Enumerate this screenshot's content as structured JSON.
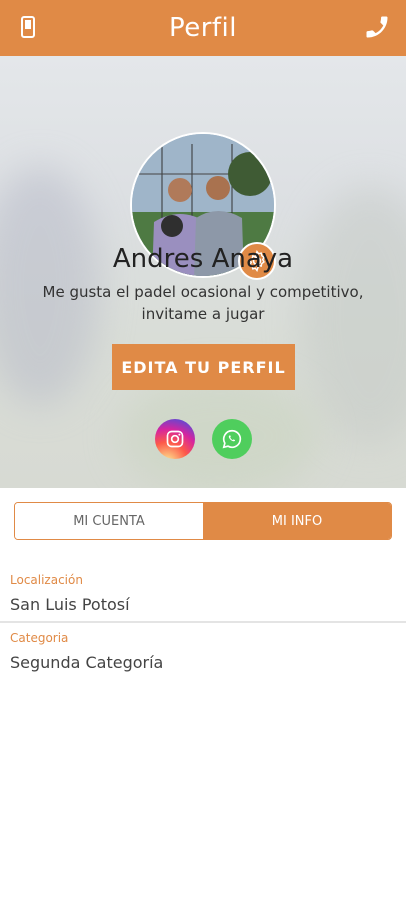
{
  "header": {
    "title": "Perfil",
    "left_icon": "phone-device-icon",
    "right_icon": "phone-handset-icon"
  },
  "profile": {
    "name": "Andres Anaya",
    "bio": "Me gusta el padel ocasional y competitivo, invitame a jugar",
    "edit_button": "EDITA TU PERFIL",
    "avatar": "profile-photo",
    "settings_icon": "gear-icon"
  },
  "social": {
    "instagram": "instagram-icon",
    "whatsapp": "whatsapp-icon"
  },
  "tabs": [
    {
      "label": "MI CUENTA",
      "active": false
    },
    {
      "label": "MI INFO",
      "active": true
    }
  ],
  "info": [
    {
      "label": "Localización",
      "value": "San Luis Potosí"
    },
    {
      "label": "Categoria",
      "value": "Segunda Categoría"
    }
  ],
  "colors": {
    "accent": "#e08a46",
    "whatsapp": "#4fce5d"
  }
}
